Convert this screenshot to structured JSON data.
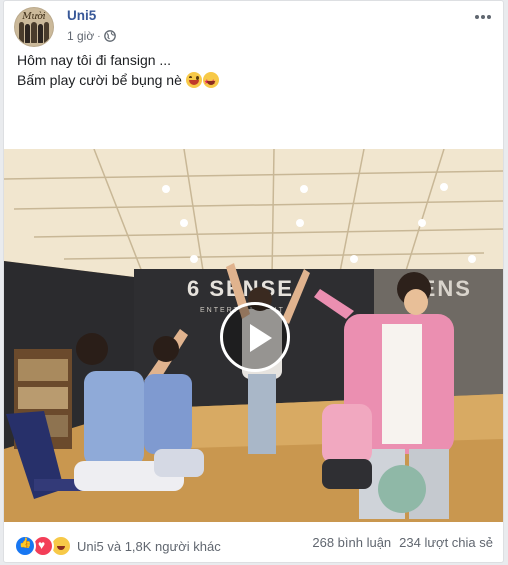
{
  "post": {
    "page_name": "Uni5",
    "time": "1 giờ",
    "separator": "·",
    "text_line1": "Hôm nay tôi đi fansign ...",
    "text_line2": "Bấm play cười bể bụng nè",
    "avatar_text": "Mười"
  },
  "video": {
    "wall_sign": "6 SENSE",
    "wall_sign_sub": "ENTERTAINMENT",
    "mirror_sign": "SENS"
  },
  "footer": {
    "reaction_summary": "Uni5 và 1,8K người khác",
    "comments": "268 bình luận",
    "shares": "234 lượt chia sẻ"
  },
  "colors": {
    "link": "#385898",
    "meta": "#616770",
    "like": "#1877f2",
    "love": "#f33e58",
    "haha": "#f7c948"
  },
  "icons": [
    "globe-icon",
    "more-icon",
    "play-icon",
    "like-icon",
    "love-icon",
    "haha-icon"
  ]
}
